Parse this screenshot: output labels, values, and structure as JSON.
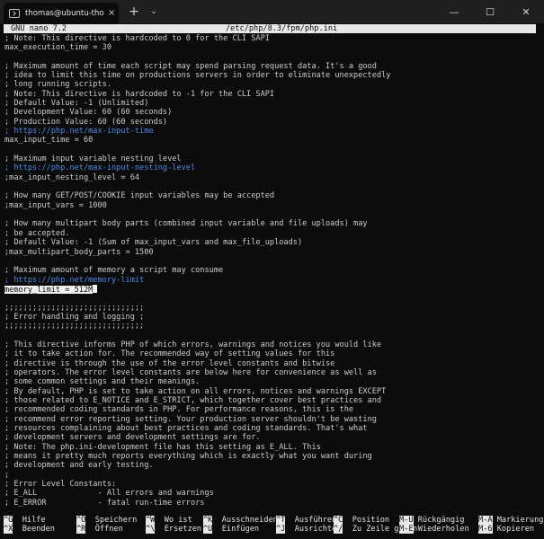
{
  "window": {
    "tab_title": "thomas@ubuntu-thomas: ~",
    "tab_close": "×",
    "new_tab": "+",
    "dropdown": "⌄",
    "minimize": "—",
    "maximize": "☐",
    "close": "✕"
  },
  "nano": {
    "version": "GNU nano 7.2",
    "filename": "/etc/php/8.3/fpm/php.ini"
  },
  "lines": [
    {
      "text": "; Note: This directive is hardcoded to 0 for the CLI SAPI",
      "kind": "text"
    },
    {
      "text": "max_execution_time = 30",
      "kind": "text"
    },
    {
      "text": "",
      "kind": "text"
    },
    {
      "text": "; Maximum amount of time each script may spend parsing request data. It's a good",
      "kind": "text"
    },
    {
      "text": "; idea to limit this time on productions servers in order to eliminate unexpectedly",
      "kind": "text"
    },
    {
      "text": "; long running scripts.",
      "kind": "text"
    },
    {
      "text": "; Note: This directive is hardcoded to -1 for the CLI SAPI",
      "kind": "text"
    },
    {
      "text": "; Default Value: -1 (Unlimited)",
      "kind": "text"
    },
    {
      "text": "; Development Value: 60 (60 seconds)",
      "kind": "text"
    },
    {
      "text": "; Production Value: 60 (60 seconds)",
      "kind": "text"
    },
    {
      "text": "; https://php.net/max-input-time",
      "kind": "link"
    },
    {
      "text": "max_input_time = 60",
      "kind": "text"
    },
    {
      "text": "",
      "kind": "text"
    },
    {
      "text": "; Maximum input variable nesting level",
      "kind": "text"
    },
    {
      "text": "; https://php.net/max-input-nesting-level",
      "kind": "link"
    },
    {
      "text": ";max_input_nesting_level = 64",
      "kind": "text"
    },
    {
      "text": "",
      "kind": "text"
    },
    {
      "text": "; How many GET/POST/COOKIE input variables may be accepted",
      "kind": "text"
    },
    {
      "text": ";max_input_vars = 1000",
      "kind": "text"
    },
    {
      "text": "",
      "kind": "text"
    },
    {
      "text": "; How many multipart body parts (combined input variable and file uploads) may",
      "kind": "text"
    },
    {
      "text": "; be accepted.",
      "kind": "text"
    },
    {
      "text": "; Default Value: -1 (Sum of max_input_vars and max_file_uploads)",
      "kind": "text"
    },
    {
      "text": ";max_multipart_body_parts = 1500",
      "kind": "text"
    },
    {
      "text": "",
      "kind": "text"
    },
    {
      "text": "; Maximum amount of memory a script may consume",
      "kind": "text"
    },
    {
      "text": "; https://php.net/memory-limit",
      "kind": "link"
    },
    {
      "text": "memory_limit = 512M",
      "kind": "selected"
    },
    {
      "text": "",
      "kind": "text"
    },
    {
      "text": ";;;;;;;;;;;;;;;;;;;;;;;;;;;;;;",
      "kind": "text"
    },
    {
      "text": "; Error handling and logging ;",
      "kind": "text"
    },
    {
      "text": ";;;;;;;;;;;;;;;;;;;;;;;;;;;;;;",
      "kind": "text"
    },
    {
      "text": "",
      "kind": "text"
    },
    {
      "text": "; This directive informs PHP of which errors, warnings and notices you would like",
      "kind": "text"
    },
    {
      "text": "; it to take action for. The recommended way of setting values for this",
      "kind": "text"
    },
    {
      "text": "; directive is through the use of the error level constants and bitwise",
      "kind": "text"
    },
    {
      "text": "; operators. The error level constants are below here for convenience as well as",
      "kind": "text"
    },
    {
      "text": "; some common settings and their meanings.",
      "kind": "text"
    },
    {
      "text": "; By default, PHP is set to take action on all errors, notices and warnings EXCEPT",
      "kind": "text"
    },
    {
      "text": "; those related to E_NOTICE and E_STRICT, which together cover best practices and",
      "kind": "text"
    },
    {
      "text": "; recommended coding standards in PHP. For performance reasons, this is the",
      "kind": "text"
    },
    {
      "text": "; recommend error reporting setting. Your production server shouldn't be wasting",
      "kind": "text"
    },
    {
      "text": "; resources complaining about best practices and coding standards. That's what",
      "kind": "text"
    },
    {
      "text": "; development servers and development settings are for.",
      "kind": "text"
    },
    {
      "text": "; Note: The php.ini-development file has this setting as E_ALL. This",
      "kind": "text"
    },
    {
      "text": "; means it pretty much reports everything which is exactly what you want during",
      "kind": "text"
    },
    {
      "text": "; development and early testing.",
      "kind": "text"
    },
    {
      "text": ";",
      "kind": "text"
    },
    {
      "text": "; Error Level Constants:",
      "kind": "text"
    },
    {
      "text": "; E_ALL             - All errors and warnings",
      "kind": "text"
    },
    {
      "text": "; E_ERROR           - fatal run-time errors",
      "kind": "text"
    }
  ],
  "shortcuts": [
    {
      "key": "^G",
      "label": "Hilfe"
    },
    {
      "key": "^X",
      "label": "Beenden"
    },
    {
      "key": "^O",
      "label": "Speichern"
    },
    {
      "key": "^R",
      "label": "Öffnen"
    },
    {
      "key": "^W",
      "label": "Wo ist"
    },
    {
      "key": "^\\",
      "label": "Ersetzen"
    },
    {
      "key": "^K",
      "label": "Ausschneiden"
    },
    {
      "key": "^U",
      "label": "Einfügen"
    },
    {
      "key": "^T",
      "label": "Ausführen"
    },
    {
      "key": "^J",
      "label": "Ausrichten"
    },
    {
      "key": "^C",
      "label": "Position"
    },
    {
      "key": "^/",
      "label": "Zu Zeile gehen"
    },
    {
      "key": "M-U",
      "label": "Rückgängig"
    },
    {
      "key": "M-E",
      "label": "Wiederholen"
    },
    {
      "key": "M-A",
      "label": "Markierung"
    },
    {
      "key": "M-6",
      "label": "Kopieren"
    }
  ]
}
